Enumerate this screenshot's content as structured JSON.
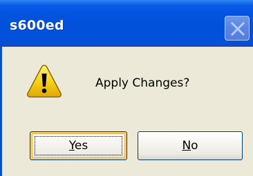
{
  "window": {
    "title": "s600ed"
  },
  "dialog": {
    "message": "Apply Changes?",
    "icon": "warning-icon"
  },
  "buttons": {
    "yes": {
      "mnemonic": "Y",
      "rest": "es"
    },
    "no": {
      "mnemonic": "N",
      "rest": "o"
    }
  },
  "colors": {
    "titlebar": "#0251d9",
    "dialog_background": "#ece9d8",
    "default_button_highlight": "#f5cf7a",
    "warning_yellow": "#f7d21c"
  }
}
